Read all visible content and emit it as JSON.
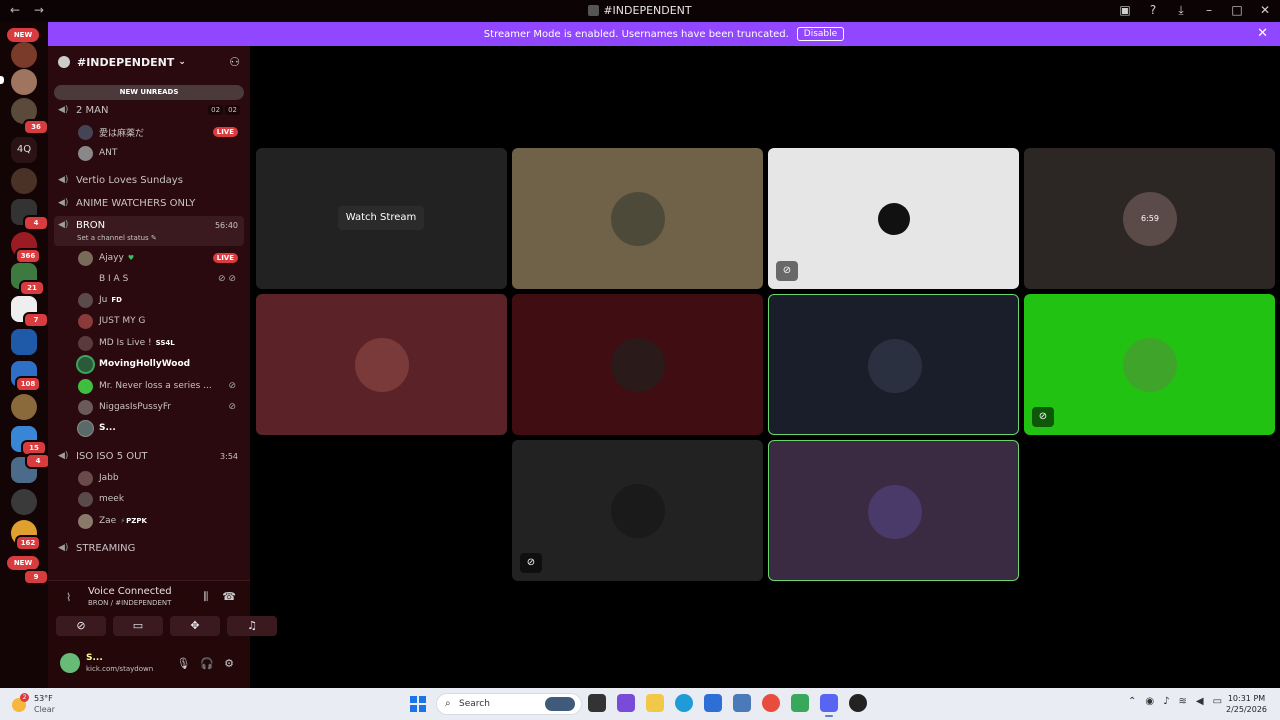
{
  "titlebar": {
    "title": "#INDEPENDENT",
    "back": "←",
    "forward": "→"
  },
  "banner": {
    "message": "Streamer Mode is enabled. Usernames have been truncated.",
    "button": "Disable"
  },
  "serverbar": {
    "badges": [
      "36",
      "4",
      "366",
      "21",
      "7",
      "108",
      "15",
      "4",
      "162",
      "9"
    ],
    "new_top": "NEW",
    "new_bottom": "NEW",
    "text_server": "4Q"
  },
  "server": {
    "name": "#INDEPENDENT",
    "new_unreads": "NEW UNREADS"
  },
  "channels": [
    {
      "name": "2 MAN",
      "counts": [
        "02",
        "02"
      ]
    },
    {
      "name": "Vertio Loves Sundays"
    },
    {
      "name": "ANIME WATCHERS ONLY"
    },
    {
      "name": "BRON",
      "time": "56:40",
      "status": "Set a channel status"
    },
    {
      "name": "ISO ISO 5 OUT",
      "time": "3:54"
    },
    {
      "name": "STREAMING"
    }
  ],
  "users_2man": [
    "愛は麻薬だ",
    "ANT"
  ],
  "users_bron": [
    "Ajayy",
    "B I A S",
    "Ju",
    "JUST MY G",
    "MD Is Live !",
    "MovingHollyWood",
    "Mr. Never loss a series ...",
    "NiggasIsPussyFr",
    "S..."
  ],
  "user_tags": {
    "ju": "FD",
    "md": "SS4L"
  },
  "users_iso": [
    "Jabb",
    "meek",
    "Zae"
  ],
  "zae_tag": "PZPK",
  "live_label": "LIVE",
  "voice": {
    "title": "Voice Connected",
    "sub": "BRON / #INDEPENDENT",
    "user": "S...",
    "user_status": "kick.com/staydown"
  },
  "stage": {
    "watch": "Watch Stream",
    "clock_text": "6:59"
  },
  "taskbar": {
    "temp": "53°F",
    "cond": "Clear",
    "alerts": "2",
    "search": "Search",
    "time": "10:31 PM",
    "date": "2/25/2026"
  },
  "colors": {
    "banner": "#9146ff",
    "live": "#d83c3e",
    "speaking": "#6dd56d"
  }
}
